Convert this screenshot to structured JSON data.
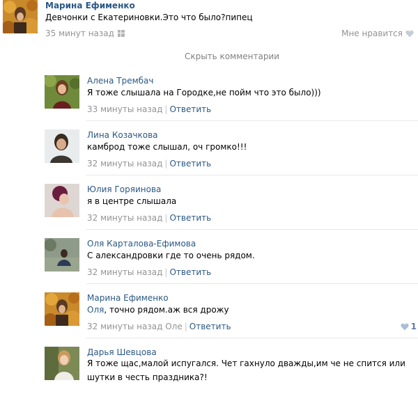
{
  "post": {
    "author": "Марина Ефименко",
    "text": "Девчонки с Екатериновки.Это что было?пипец",
    "time": "35 минут назад",
    "like_label": "Мне нравится"
  },
  "hide_comments_label": "Скрыть комментарии",
  "reply_label": "Ответить",
  "replies": [
    {
      "author": "Алена Трембач",
      "text": "Я тоже слышала на Городке,не пойм что это было)))",
      "time": "33 минуты назад"
    },
    {
      "author": "Лина Козачкова",
      "text": "камброд тоже слышал, оч громко!!!",
      "time": "32 минуты назад"
    },
    {
      "author": "Юлия Горяинова",
      "text": "я в центре слышала",
      "time": "32 минуты назад"
    },
    {
      "author": "Оля Карталова-Ефимова",
      "text": "С александровки где то очень рядом.",
      "time": "32 минуты назад"
    },
    {
      "author": "Марина Ефименко",
      "mention": "Оля",
      "text": ", точно рядом.аж вся дрожу",
      "time": "32 минуты назад",
      "reply_to": "Оле",
      "likes": "1"
    },
    {
      "author": "Дарья Шевцова",
      "text": "Я тоже щас,малой испугался. Чет гахнуло дважды,им че не спится или шутки в честь праздника?!"
    }
  ],
  "colors": {
    "link": "#2a5885",
    "meta": "#939393",
    "separator": "#e7e8ec"
  }
}
